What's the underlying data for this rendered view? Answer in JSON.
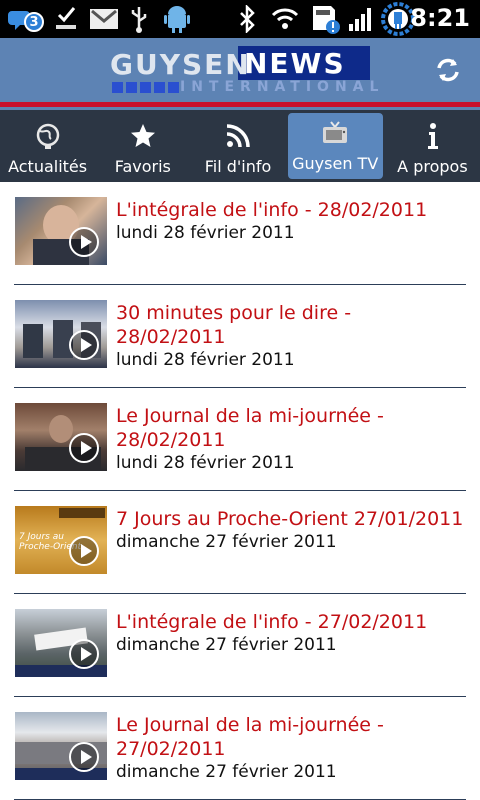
{
  "status_bar": {
    "notification_count": "3",
    "time": "8:21",
    "icons": [
      "notification-icon",
      "download-icon",
      "gmail-icon",
      "usb-icon",
      "android-icon",
      "bluetooth-icon",
      "wifi-icon",
      "sd-card-icon",
      "signal-icon",
      "battery-icon"
    ]
  },
  "header": {
    "logo_word1": "GUYSEN",
    "logo_word2": "NEWS",
    "logo_sub": "INTERNATIONAL",
    "accent_red": "#c8102e",
    "header_blue": "#5d83b4",
    "refresh_icon": "refresh-icon"
  },
  "tabs": [
    {
      "label": "Actualités",
      "icon": "globe-icon",
      "active": false
    },
    {
      "label": "Favoris",
      "icon": "star-icon",
      "active": false
    },
    {
      "label": "Fil d'info",
      "icon": "rss-icon",
      "active": false
    },
    {
      "label": "Guysen TV",
      "icon": "tv-icon",
      "active": true
    },
    {
      "label": "A propos",
      "icon": "info-icon",
      "active": false
    }
  ],
  "videos": [
    {
      "title": "L'intégrale de l'info - 28/02/2011",
      "date": "lundi 28 février 2011"
    },
    {
      "title": "30 minutes pour le dire - 28/02/2011",
      "date": "lundi 28 février 2011"
    },
    {
      "title": "Le Journal de la mi-journée - 28/02/2011",
      "date": "lundi 28 février 2011"
    },
    {
      "title": "7 Jours au Proche-Orient 27/01/2011",
      "date": "dimanche 27 février 2011"
    },
    {
      "title": "L'intégrale de l'info - 27/02/2011",
      "date": "dimanche 27 février 2011"
    },
    {
      "title": "Le Journal de la mi-journée - 27/02/2011",
      "date": "dimanche 27 février 2011"
    }
  ]
}
